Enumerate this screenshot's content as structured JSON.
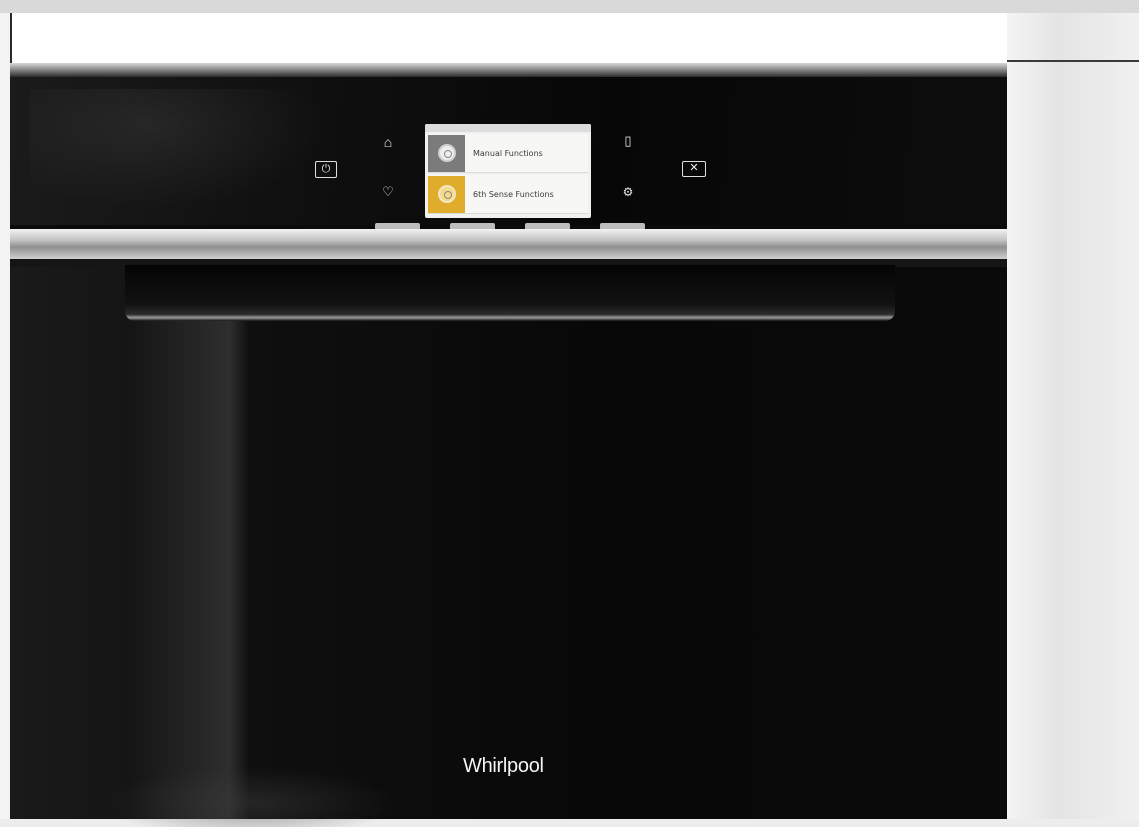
{
  "control_panel": {
    "icons": {
      "power": "power-icon",
      "home": "home-icon",
      "favorites": "heart-icon",
      "remote": "smartphone-icon",
      "settings": "gears-icon",
      "close": "close-icon"
    },
    "glyphs": {
      "power": "⏻",
      "home": "⌂",
      "favorites": "♡",
      "remote": "▯",
      "settings": "⚙",
      "close": "✕"
    }
  },
  "display": {
    "menu_items": [
      {
        "label": "Manual Functions",
        "icon": "dial-icon",
        "color": "#7b7b7b"
      },
      {
        "label": "6th Sense Functions",
        "icon": "dial-icon",
        "color": "#e0ac2b"
      }
    ]
  },
  "brand": {
    "logo_text": "Whirlpool"
  }
}
